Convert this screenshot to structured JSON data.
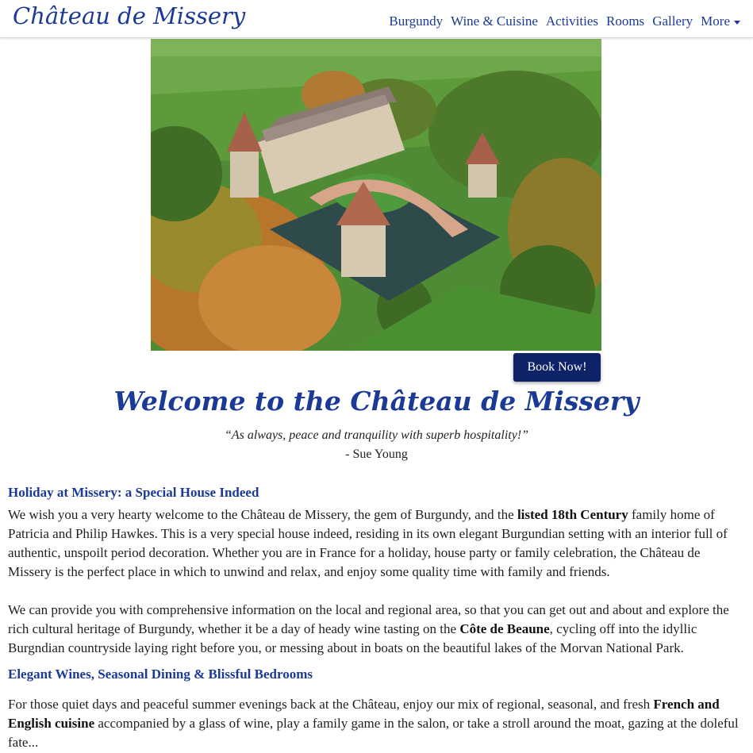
{
  "header": {
    "brand": "Château de Missery",
    "nav": [
      {
        "label": "Burgundy"
      },
      {
        "label": "Wine & Cuisine"
      },
      {
        "label": "Activities"
      },
      {
        "label": "Rooms"
      },
      {
        "label": "Gallery"
      },
      {
        "label": "More"
      }
    ]
  },
  "hero": {
    "book_label": "Book Now!"
  },
  "intro": {
    "welcome": "Welcome to the Château de Missery",
    "quote": "“As always, peace and tranquility with superb hospitality!”",
    "quote_author": "- Sue Young"
  },
  "sections": {
    "s1_title": "Holiday at Missery: a Special House Indeed",
    "p1_a": "We wish you a very hearty welcome to the Château de Missery, the gem of Burgundy, and the ",
    "p1_b": "listed 18th Century",
    "p1_c": " family home of Patricia and Philip Hawkes. This is a very special house indeed, residing in its own elegant Burgundian setting with an interior full of authentic, unspoilt period decoration. Whether you are in France for a holiday, house party or family celebration, the Château de Missery is the perfect place in which to unwind and relax, and enjoy some quality time with family and friends.",
    "p2_a": "We can provide you with comprehensive information on the local and regional area, so that you can get out and about and explore the rich cultural heritage of Burgundy, whether it be a day of heady wine tasting on the ",
    "p2_b": "Côte de Beaune",
    "p2_c": ", cycling off into the idyllic Burgndian countryside laying right before you, or messing about in boats on the beautiful lakes of the Morvan National Park.",
    "s2_title": "Elegant Wines, Seasonal Dining & Blissful Bedrooms",
    "p3_a": "For those quiet days and peaceful summer evenings back at the Château, enjoy our mix of regional, seasonal, and fresh ",
    "p3_b": "French and English cuisine",
    "p3_c": " accompanied by a glass of wine, play a family game in the salon, or take a stroll around the moat, gazing at the doleful fate..."
  },
  "colors": {
    "brand_blue": "#1b3a96",
    "button_navy": "#0e2268"
  }
}
